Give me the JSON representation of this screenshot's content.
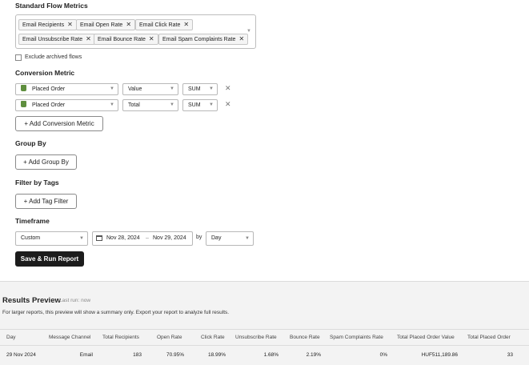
{
  "metrics": {
    "label": "Standard Flow Metrics",
    "chips": [
      "Email Recipients",
      "Email Open Rate",
      "Email Click Rate",
      "Email Unsubscribe Rate",
      "Email Bounce Rate",
      "Email Spam Complaints Rate"
    ],
    "exclude_archived_label": "Exclude archived flows",
    "exclude_archived_checked": false
  },
  "conversion": {
    "label": "Conversion Metric",
    "rows": [
      {
        "metric": "Placed Order",
        "field": "Value",
        "agg": "SUM"
      },
      {
        "metric": "Placed Order",
        "field": "Total",
        "agg": "SUM"
      }
    ],
    "add_label": "+ Add Conversion Metric"
  },
  "group_by": {
    "label": "Group By",
    "add_label": "+ Add Group By"
  },
  "filter_tags": {
    "label": "Filter by Tags",
    "add_label": "+ Add Tag Filter"
  },
  "timeframe": {
    "label": "Timeframe",
    "preset": "Custom",
    "start": "Nov 28, 2024",
    "separator": "–",
    "end": "Nov 29, 2024",
    "by_label": "by",
    "granularity": "Day"
  },
  "run_button": "Save & Run Report",
  "results": {
    "title": "Results Preview",
    "last_run": "Last run: now",
    "note": "For larger reports, this preview will show a summary only. Export your report to analyze full results.",
    "columns": [
      "Day",
      "Message Channel",
      "Total Recipients",
      "Open Rate",
      "Click Rate",
      "Unsubscribe Rate",
      "Bounce Rate",
      "Spam Complaints Rate",
      "Total Placed Order Value",
      "Total Placed Order"
    ],
    "rows": [
      [
        "29 Nov 2024",
        "Email",
        "183",
        "70.95%",
        "18.99%",
        "1.68%",
        "2.19%",
        "0%",
        "HUF511,189.86",
        "33"
      ]
    ]
  },
  "colors": {
    "primary_button": "#1c1c1c",
    "shopify_icon": "#5e8e3e"
  },
  "icons": [
    "close-icon",
    "chevron-down-icon",
    "calendar-icon",
    "shopify-icon"
  ]
}
